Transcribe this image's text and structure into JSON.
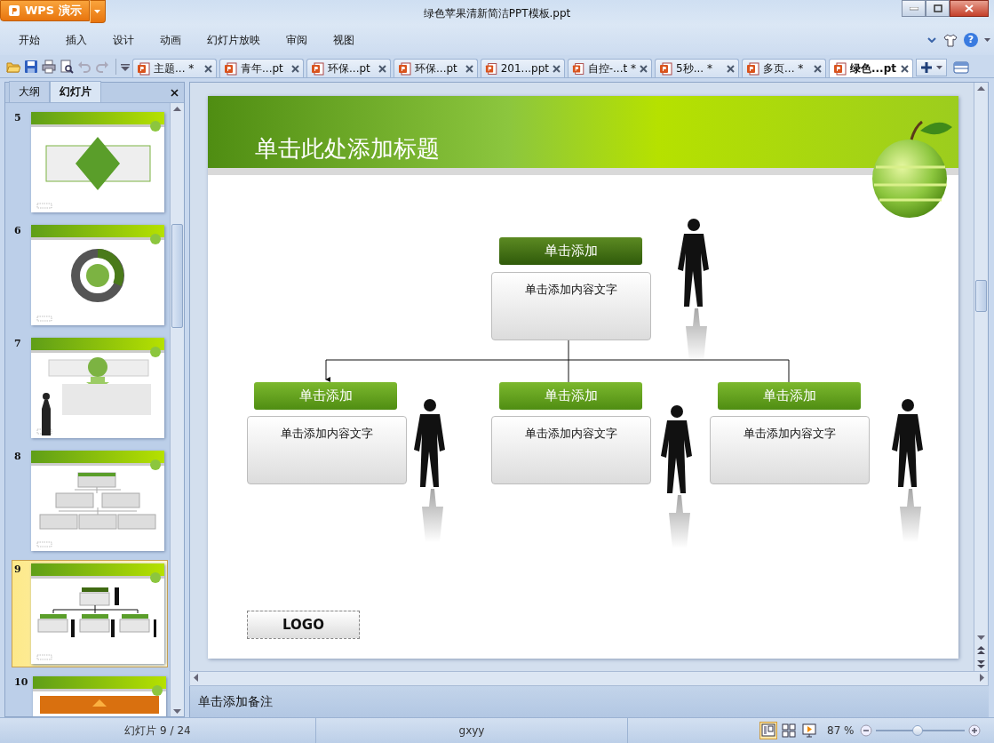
{
  "window": {
    "app_button": "WPS 演示",
    "title": "绿色苹果清新简洁PPT模板.ppt"
  },
  "menu": [
    "开始",
    "插入",
    "设计",
    "动画",
    "幻灯片放映",
    "审阅",
    "视图"
  ],
  "help": "?",
  "doc_tabs": [
    {
      "label": "主题... *",
      "selected": false
    },
    {
      "label": "青年...pt",
      "selected": false
    },
    {
      "label": "环保...pt",
      "selected": false
    },
    {
      "label": "环保...pt",
      "selected": false
    },
    {
      "label": "201...ppt",
      "selected": false
    },
    {
      "label": "自控-...t *",
      "selected": false
    },
    {
      "label": "5秒... *",
      "selected": false
    },
    {
      "label": "多页... *",
      "selected": false
    },
    {
      "label": "绿色...pt",
      "selected": true
    }
  ],
  "panel": {
    "tabs": [
      {
        "label": "大纲",
        "selected": false
      },
      {
        "label": "幻灯片",
        "selected": true
      }
    ]
  },
  "thumbnails": [
    {
      "number": "5",
      "kind": "diamond",
      "selected": false
    },
    {
      "number": "6",
      "kind": "cycle",
      "selected": false
    },
    {
      "number": "7",
      "kind": "arrows",
      "selected": false
    },
    {
      "number": "8",
      "kind": "hierarchy",
      "selected": false
    },
    {
      "number": "9",
      "kind": "org",
      "selected": true
    },
    {
      "number": "10",
      "kind": "banner",
      "selected": false
    }
  ],
  "slide": {
    "title": "单击此处添加标题",
    "nodes": [
      {
        "heading": "单击添加",
        "body": "单击添加内容文字"
      },
      {
        "heading": "单击添加",
        "body": "单击添加内容文字"
      },
      {
        "heading": "单击添加",
        "body": "单击添加内容文字"
      },
      {
        "heading": "单击添加",
        "body": "单击添加内容文字"
      }
    ],
    "logo": "LOGO"
  },
  "notes": "单击添加备注",
  "status_bar": {
    "slide_counter": "幻灯片 9 / 24",
    "theme": "gxyy",
    "views": [
      {
        "kind": "normal",
        "selected": true
      },
      {
        "kind": "sorter",
        "selected": false
      },
      {
        "kind": "show",
        "selected": false
      }
    ],
    "zoom": "87 %",
    "zoom_slider": {
      "level": 0.47
    }
  }
}
